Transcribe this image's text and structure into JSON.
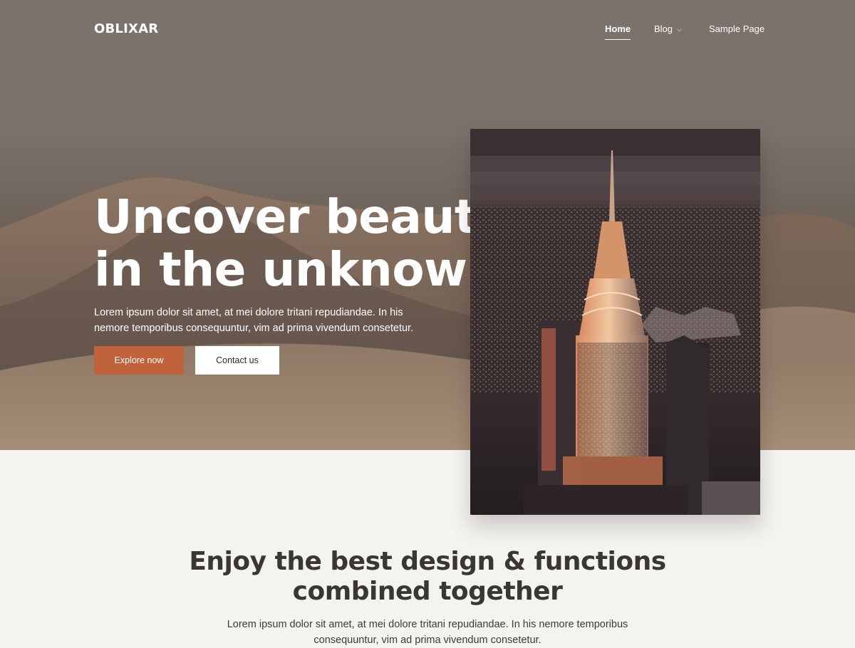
{
  "header": {
    "logo": "OBLIXAR",
    "nav": {
      "home": "Home",
      "blog": "Blog",
      "sample": "Sample Page"
    },
    "blog_icon": "chevron-down-icon"
  },
  "hero": {
    "headline_line1": "Uncover beauty",
    "headline_line2": "in the unknown.",
    "text": "Lorem ipsum dolor sit amet, at mei dolore tritani repudiandae. In his nemore temporibus consequuntur, vim ad prima vivendum consetetur.",
    "explore_label": "Explore now",
    "contact_label": "Contact us"
  },
  "feature": {
    "title_line1": "Enjoy the best design & functions",
    "title_line2": "combined together",
    "text": "Lorem ipsum dolor sit amet, at mei dolore tritani repudiandae. In his nemore temporibus consequuntur, vim ad prima vivendum consetetur."
  },
  "colors": {
    "accent": "#c0633a",
    "page_background": "#f4f3ef",
    "heading_dark": "#3a3634"
  }
}
